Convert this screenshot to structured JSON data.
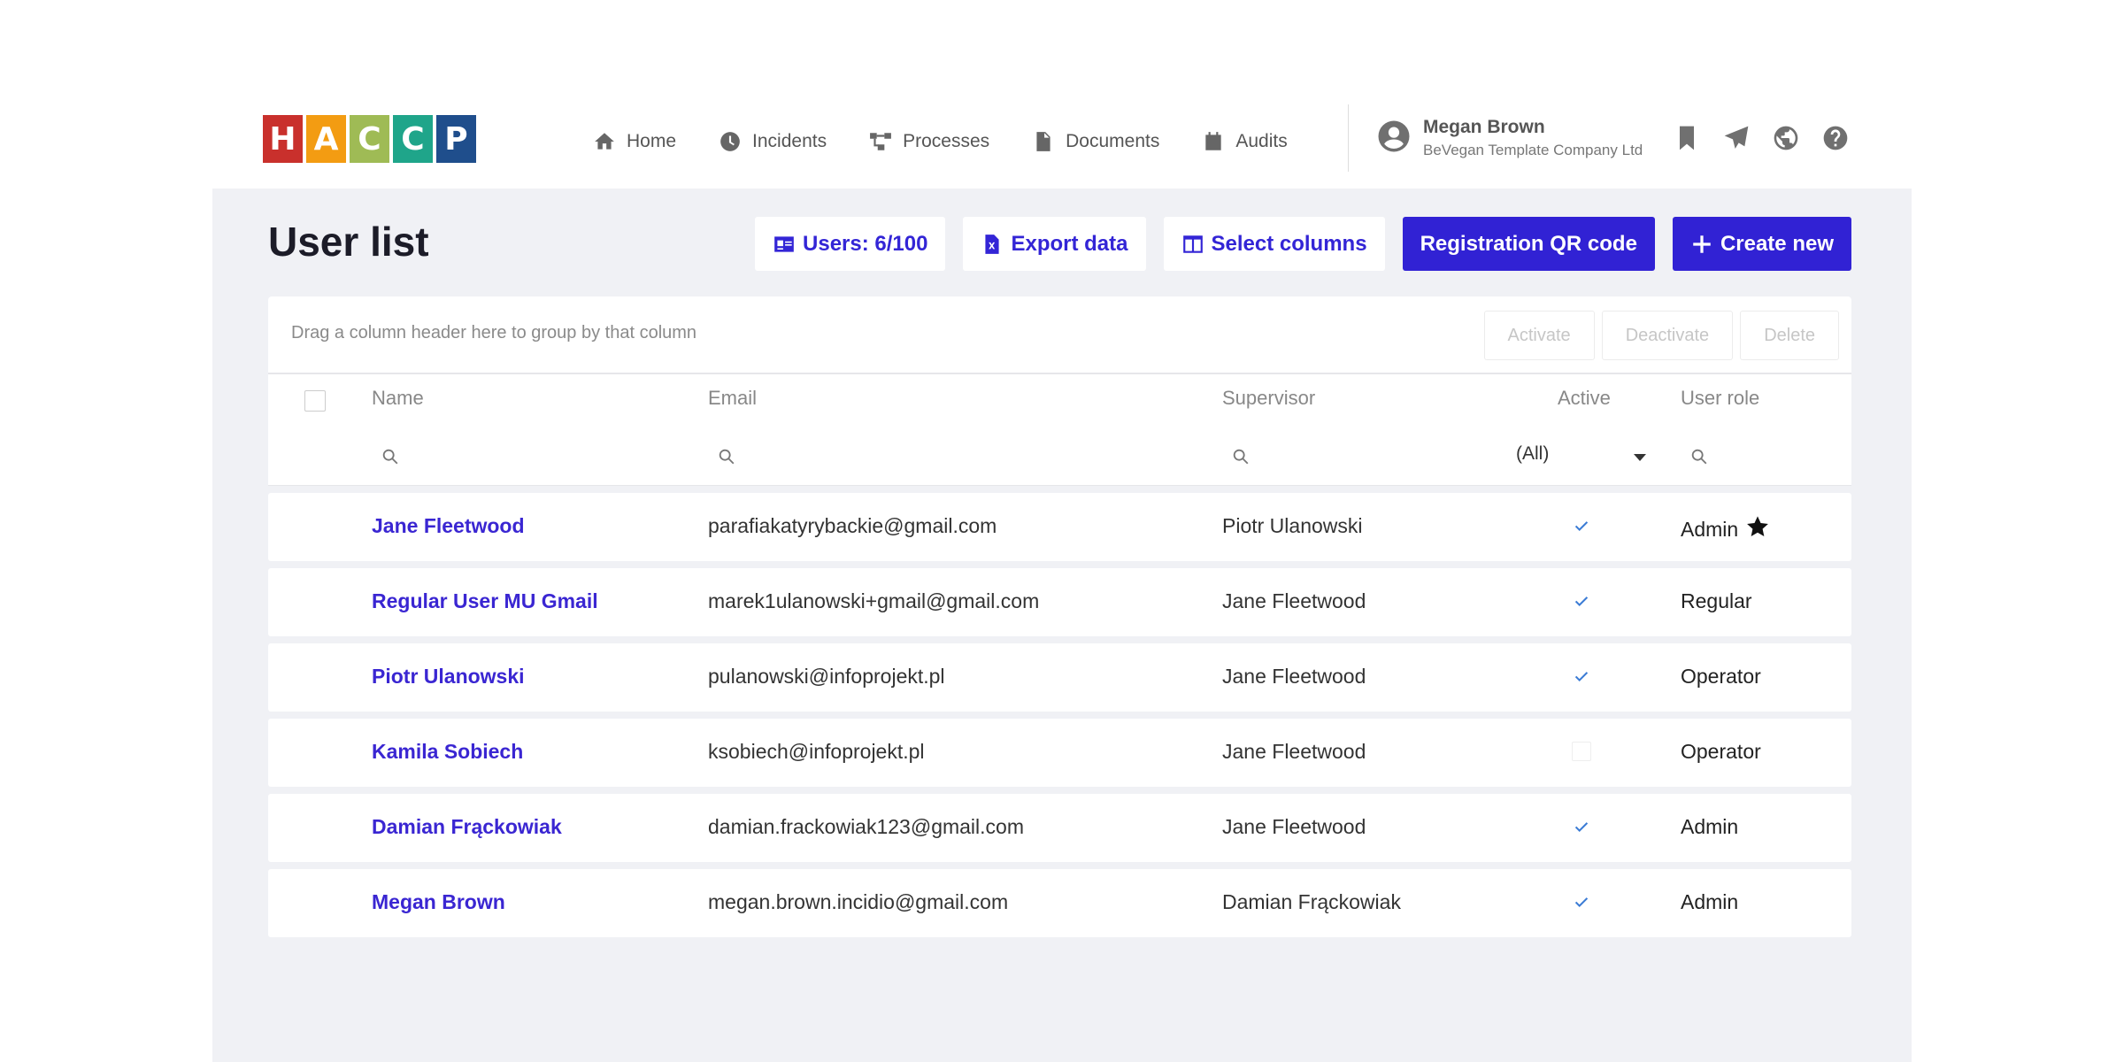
{
  "logo": {
    "letters": [
      "H",
      "A",
      "C",
      "C",
      "P"
    ],
    "colors": [
      "#c9302c",
      "#f39c12",
      "#9fbb55",
      "#1fa58a",
      "#1f4e8c"
    ]
  },
  "nav": [
    {
      "label": "Home",
      "icon": "home-icon"
    },
    {
      "label": "Incidents",
      "icon": "clock-icon"
    },
    {
      "label": "Processes",
      "icon": "process-icon"
    },
    {
      "label": "Documents",
      "icon": "document-icon"
    },
    {
      "label": "Audits",
      "icon": "calendar-icon"
    }
  ],
  "user": {
    "name": "Megan Brown",
    "company": "BeVegan Template Company Ltd"
  },
  "top_icons": [
    "bookmark-icon",
    "paper-plane-icon",
    "globe-icon",
    "help-icon"
  ],
  "page": {
    "title": "User list"
  },
  "toolbar": {
    "users_count": "Users: 6/100",
    "export_label": "Export data",
    "columns_label": "Select columns",
    "qr_label": "Registration QR code",
    "create_label": "Create new"
  },
  "grid": {
    "group_hint": "Drag a column header here to group by that column",
    "actions": {
      "activate": "Activate",
      "deactivate": "Deactivate",
      "delete": "Delete"
    },
    "columns": {
      "name": "Name",
      "email": "Email",
      "supervisor": "Supervisor",
      "active": "Active",
      "role": "User role"
    },
    "active_filter": "(All)",
    "rows": [
      {
        "name": "Jane Fleetwood",
        "email": "parafiakatyrybackie@gmail.com",
        "supervisor": "Piotr Ulanowski",
        "active": true,
        "role": "Admin",
        "starred": true
      },
      {
        "name": "Regular User MU Gmail",
        "email": "marek1ulanowski+gmail@gmail.com",
        "supervisor": "Jane Fleetwood",
        "active": true,
        "role": "Regular",
        "starred": false
      },
      {
        "name": "Piotr Ulanowski",
        "email": "pulanowski@infoprojekt.pl",
        "supervisor": "Jane Fleetwood",
        "active": true,
        "role": "Operator",
        "starred": false
      },
      {
        "name": "Kamila Sobiech",
        "email": "ksobiech@infoprojekt.pl",
        "supervisor": "Jane Fleetwood",
        "active": false,
        "role": "Operator",
        "starred": false
      },
      {
        "name": "Damian Frąckowiak",
        "email": "damian.frackowiak123@gmail.com",
        "supervisor": "Jane Fleetwood",
        "active": true,
        "role": "Admin",
        "starred": false
      },
      {
        "name": "Megan Brown",
        "email": "megan.brown.incidio@gmail.com",
        "supervisor": "Damian Frąckowiak",
        "active": true,
        "role": "Admin",
        "starred": false
      }
    ]
  },
  "colors": {
    "accent": "#3122d4",
    "link": "#3a26d2",
    "panel_bg": "#f0f1f5",
    "check": "#3a7bd5"
  }
}
